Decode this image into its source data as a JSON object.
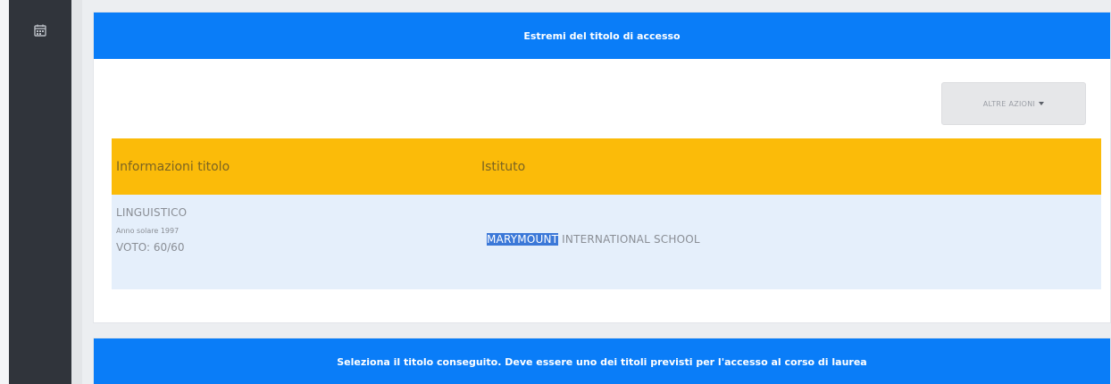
{
  "sidebar": {
    "icon": "calendar-icon"
  },
  "card1": {
    "header": "Estremi del titolo di accesso",
    "actions_button": "ALTRE AZIONI"
  },
  "table": {
    "columns": [
      "Informazioni titolo",
      "Istituto"
    ],
    "rows": [
      {
        "titolo": "LINGUISTICO",
        "anno": "Anno solare 1997",
        "voto": "VOTO: 60/60",
        "istituto_selected": "MARYMOUNT",
        "istituto_rest": " INTERNATIONAL SCHOOL"
      }
    ]
  },
  "card2": {
    "header": "Seleziona il titolo conseguito. Deve essere uno dei titoli previsti per l'accesso al corso di laurea"
  },
  "colors": {
    "primary": "#0a7df8",
    "table_header": "#fbbb09",
    "row_bg": "#e5effb",
    "sidebar": "#30343b",
    "selection": "#3b78d8"
  }
}
